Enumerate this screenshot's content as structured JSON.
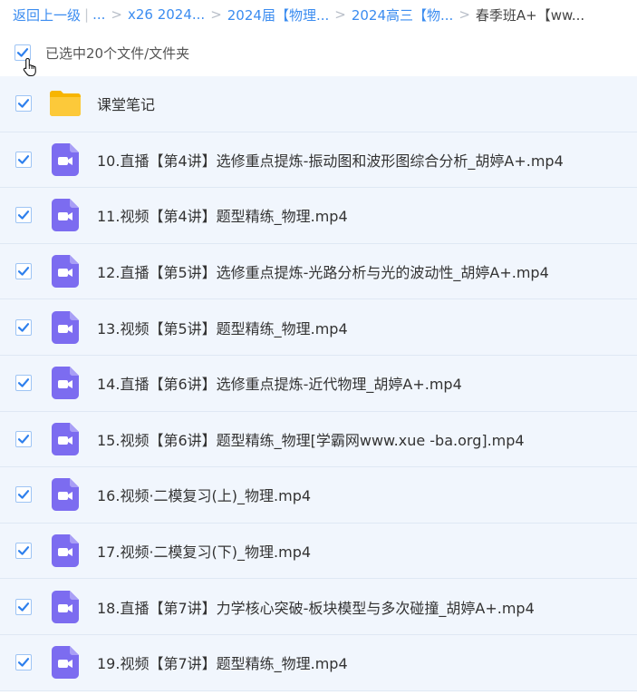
{
  "breadcrumb": {
    "back": "返回上一级",
    "pipe": "|",
    "ellipsis": "...",
    "items": [
      {
        "label": "x26 2024..."
      },
      {
        "label": "2024届【物理..."
      },
      {
        "label": "2024高三【物..."
      }
    ],
    "separator": ">",
    "current": "春季班A+【ww..."
  },
  "selection": {
    "text": "已选中20个文件/文件夹",
    "checked": true
  },
  "colors": {
    "accent": "#3b8cf0",
    "folder": "#fcc93a",
    "video": "#7c6cf0",
    "row_bg": "#f1f6fd"
  },
  "files": [
    {
      "name": "课堂笔记",
      "icon": "folder-icon",
      "checked": true
    },
    {
      "name": "10.直播【第4讲】选修重点提炼-振动图和波形图综合分析_胡婷A+.mp4",
      "icon": "video-file-icon",
      "checked": true
    },
    {
      "name": "11.视频【第4讲】题型精练_物理.mp4",
      "icon": "video-file-icon",
      "checked": true
    },
    {
      "name": "12.直播【第5讲】选修重点提炼-光路分析与光的波动性_胡婷A+.mp4",
      "icon": "video-file-icon",
      "checked": true
    },
    {
      "name": "13.视频【第5讲】题型精练_物理.mp4",
      "icon": "video-file-icon",
      "checked": true
    },
    {
      "name": "14.直播【第6讲】选修重点提炼-近代物理_胡婷A+.mp4",
      "icon": "video-file-icon",
      "checked": true
    },
    {
      "name": "15.视频【第6讲】题型精练_物理[学霸网www.xue -ba.org].mp4",
      "icon": "video-file-icon",
      "checked": true
    },
    {
      "name": "16.视频·二模复习(上)_物理.mp4",
      "icon": "video-file-icon",
      "checked": true
    },
    {
      "name": "17.视频·二模复习(下)_物理.mp4",
      "icon": "video-file-icon",
      "checked": true
    },
    {
      "name": "18.直播【第7讲】力学核心突破-板块模型与多次碰撞_胡婷A+.mp4",
      "icon": "video-file-icon",
      "checked": true
    },
    {
      "name": "19.视频【第7讲】题型精练_物理.mp4",
      "icon": "video-file-icon",
      "checked": true
    }
  ]
}
